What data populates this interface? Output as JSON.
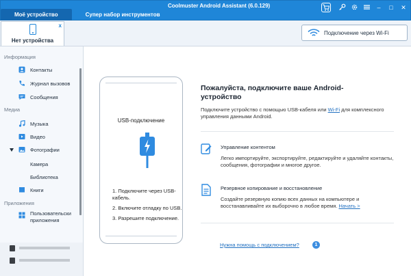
{
  "window": {
    "title": "Coolmuster Android Assistant (6.0.129)",
    "tabs": [
      "Моё устройство",
      "Супер набор инструментов"
    ],
    "controls": {
      "store": "cart-icon",
      "key": "key-icon",
      "settings": "gear-icon",
      "menu": "menu-icon",
      "minimize": "–",
      "maximize": "□",
      "close": "✕"
    }
  },
  "device": {
    "tab_label": "Нет устройства",
    "close": "x",
    "wifi_button": "Подключение через Wi-Fi"
  },
  "sidebar": {
    "sections": {
      "info": "Информация",
      "media": "Медиа",
      "apps": "Приложения"
    },
    "items": {
      "contacts": "Контакты",
      "calls": "Журнал вызовов",
      "messages": "Сообщения",
      "music": "Музыка",
      "video": "Видео",
      "photos": "Фотографии",
      "camera": "Камера",
      "library": "Библиотека",
      "books": "Книги",
      "user_apps_1": "Пользовательски",
      "user_apps_2": "приложения"
    }
  },
  "main": {
    "usb_title": "USB-подключение",
    "steps": [
      "1. Подключите через USB-кабель.",
      "2. Включите отладку по USB.",
      "3. Разрешите подключение."
    ],
    "heading": "Пожалуйста, подключите ваше Android-устройство",
    "desc_pre": "Подключите устройство с помощью USB-кабеля или ",
    "desc_link": "Wi-Fi",
    "desc_post": " для комплексного управления данными Android.",
    "feature1_title": "Управление контентом",
    "feature1_desc": "Легко импортируйте, экспортируйте, редактируйте и удаляйте контакты, сообщения, фотографии и многое другое.",
    "feature2_title": "Резервное копирование и восстановление",
    "feature2_desc": "Создайте резервную копию всех данных на компьютере и восстанавливайте их выборочно в любое время. ",
    "feature2_link": "Начать >",
    "help_link": "Нужна помощь с подключением?",
    "help_badge": "1"
  },
  "colors": {
    "accent": "#1f86d8",
    "link": "#1f6fc0",
    "icon": "#2f8be0"
  }
}
